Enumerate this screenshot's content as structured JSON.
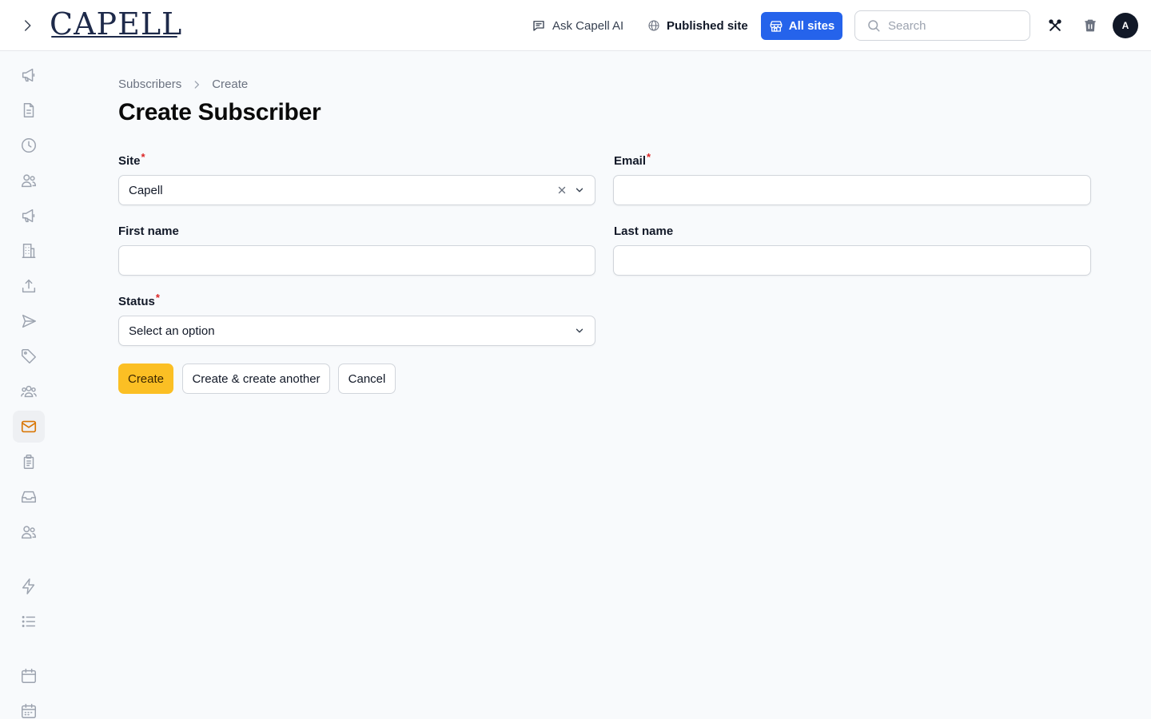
{
  "header": {
    "logo_text": "CAPELL",
    "ask_ai_label": "Ask Capell AI",
    "published_site_label": "Published site",
    "all_sites_label": "All sites",
    "search_placeholder": "Search",
    "avatar_initial": "A"
  },
  "sidebar": {
    "items": [
      {
        "icon": "megaphone-icon",
        "active": false
      },
      {
        "icon": "document-icon",
        "active": false
      },
      {
        "icon": "clock-icon",
        "active": false
      },
      {
        "icon": "users-icon",
        "active": false
      },
      {
        "icon": "megaphone-icon",
        "active": false
      },
      {
        "icon": "building-icon",
        "active": false
      },
      {
        "icon": "upload-icon",
        "active": false
      },
      {
        "icon": "send-icon",
        "active": false
      },
      {
        "icon": "tag-icon",
        "active": false
      },
      {
        "icon": "user-group-icon",
        "active": false
      },
      {
        "icon": "envelope-icon",
        "active": true
      },
      {
        "icon": "clipboard-icon",
        "active": false
      },
      {
        "icon": "inbox-icon",
        "active": false
      },
      {
        "icon": "users-icon",
        "active": false
      },
      {
        "icon": "bolt-icon",
        "active": false
      },
      {
        "icon": "list-icon",
        "active": false
      },
      {
        "icon": "calendar-icon",
        "active": false
      },
      {
        "icon": "calendar-days-icon",
        "active": false
      }
    ]
  },
  "breadcrumb": {
    "parent": "Subscribers",
    "current": "Create"
  },
  "page": {
    "title": "Create Subscriber"
  },
  "form": {
    "site": {
      "label": "Site",
      "required_mark": "*",
      "value": "Capell"
    },
    "email": {
      "label": "Email",
      "required_mark": "*",
      "value": ""
    },
    "first_name": {
      "label": "First name",
      "value": ""
    },
    "last_name": {
      "label": "Last name",
      "value": ""
    },
    "status": {
      "label": "Status",
      "required_mark": "*",
      "placeholder": "Select an option"
    }
  },
  "actions": {
    "create_label": "Create",
    "create_another_label": "Create & create another",
    "cancel_label": "Cancel"
  },
  "colors": {
    "accent": "#2563eb",
    "primary_button": "#fbbf24",
    "active_icon": "#d97706",
    "required": "#dc2626"
  }
}
